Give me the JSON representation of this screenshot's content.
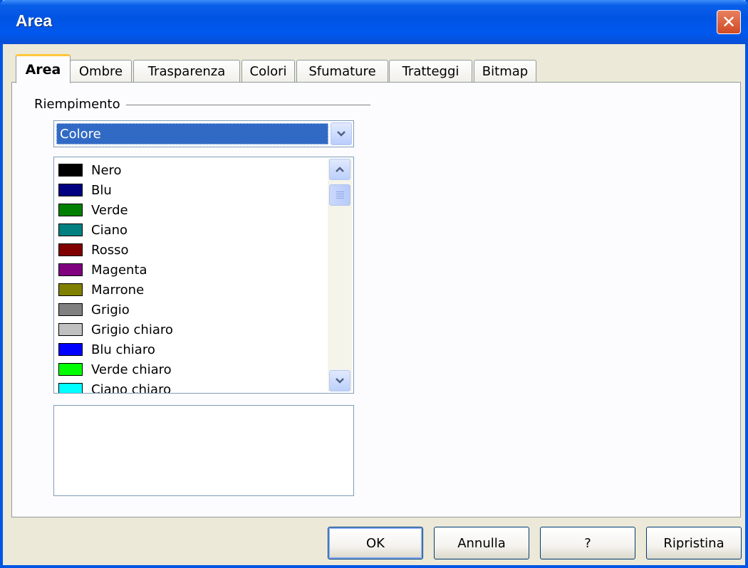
{
  "window": {
    "title": "Area",
    "close_glyph": "✕"
  },
  "tabs": [
    {
      "label": "Area",
      "active": true
    },
    {
      "label": "Ombre"
    },
    {
      "label": "Trasparenza"
    },
    {
      "label": "Colori"
    },
    {
      "label": "Sfumature"
    },
    {
      "label": "Tratteggi"
    },
    {
      "label": "Bitmap"
    }
  ],
  "fill": {
    "group_label": "Riempimento",
    "selected_type": "Colore",
    "colors": [
      {
        "name": "Nero",
        "color": "#000000"
      },
      {
        "name": "Blu",
        "color": "#000080"
      },
      {
        "name": "Verde",
        "color": "#008000"
      },
      {
        "name": "Ciano",
        "color": "#008080"
      },
      {
        "name": "Rosso",
        "color": "#800000"
      },
      {
        "name": "Magenta",
        "color": "#800080"
      },
      {
        "name": "Marrone",
        "color": "#808000"
      },
      {
        "name": "Grigio",
        "color": "#808080"
      },
      {
        "name": "Grigio chiaro",
        "color": "#c0c0c0"
      },
      {
        "name": "Blu chiaro",
        "color": "#0000ff"
      },
      {
        "name": "Verde chiaro",
        "color": "#00ff00"
      },
      {
        "name": "Ciano chiaro",
        "color": "#00ffff"
      }
    ]
  },
  "buttons": {
    "ok": "OK",
    "cancel": "Annulla",
    "help": "?",
    "reset": "Ripristina"
  },
  "icons": {
    "close": "close-icon",
    "dropdown": "chevron-down-icon",
    "scroll_up": "chevron-up-icon",
    "scroll_down": "chevron-down-icon"
  }
}
